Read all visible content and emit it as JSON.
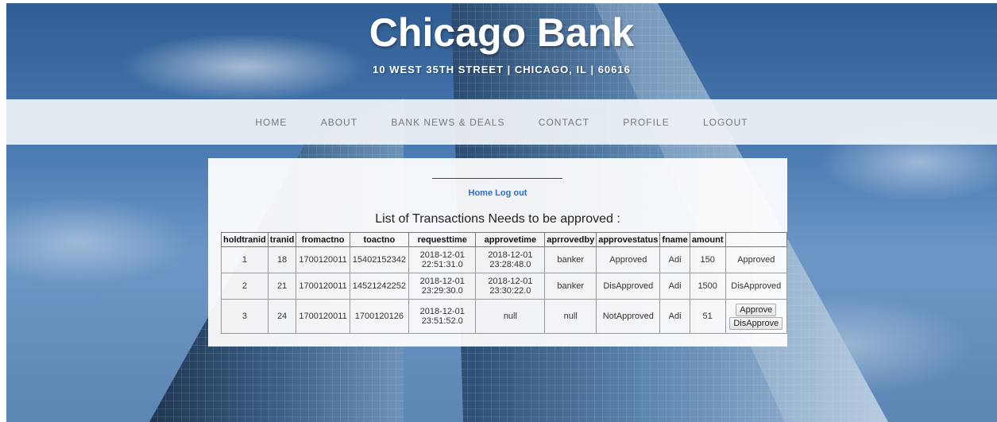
{
  "header": {
    "title": "Chicago Bank",
    "address": "10 WEST 35TH STREET | CHICAGO, IL | 60616"
  },
  "nav": {
    "items": [
      "HOME",
      "ABOUT",
      "BANK NEWS & DEALS",
      "CONTACT",
      "PROFILE",
      "LOGOUT"
    ]
  },
  "panel": {
    "links": {
      "home": "Home",
      "logout": "Log out"
    },
    "list_title": "List of Transactions Needs to be approved :"
  },
  "table": {
    "headers": [
      "holdtranid",
      "tranid",
      "fromactno",
      "toactno",
      "requesttime",
      "approvetime",
      "aprrovedby",
      "approvestatus",
      "fname",
      "amount",
      ""
    ],
    "rows": [
      {
        "holdtranid": "1",
        "tranid": "18",
        "fromactno": "1700120011",
        "toactno": "15402152342",
        "requesttime_date": "2018-12-01",
        "requesttime_time": "22:51:31.0",
        "approvetime_date": "2018-12-01",
        "approvetime_time": "23:28:48.0",
        "aprrovedby": "banker",
        "approvestatus": "Approved",
        "fname": "Adi",
        "amount": "150",
        "action": "Approved"
      },
      {
        "holdtranid": "2",
        "tranid": "21",
        "fromactno": "1700120011",
        "toactno": "14521242252",
        "requesttime_date": "2018-12-01",
        "requesttime_time": "23:29:30.0",
        "approvetime_date": "2018-12-01",
        "approvetime_time": "23:30:22.0",
        "aprrovedby": "banker",
        "approvestatus": "DisApproved",
        "fname": "Adi",
        "amount": "1500",
        "action": "DisApproved"
      },
      {
        "holdtranid": "3",
        "tranid": "24",
        "fromactno": "1700120011",
        "toactno": "1700120126",
        "requesttime_date": "2018-12-01",
        "requesttime_time": "23:51:52.0",
        "approvetime": "null",
        "aprrovedby": "null",
        "approvestatus": "NotApproved",
        "fname": "Adi",
        "amount": "51",
        "approve_button": "Approve",
        "disapprove_button": "DisApprove"
      }
    ]
  },
  "colors": {
    "link": "#2a6fd6",
    "nav_text": "#777777",
    "sky": "#4b7bb3"
  }
}
